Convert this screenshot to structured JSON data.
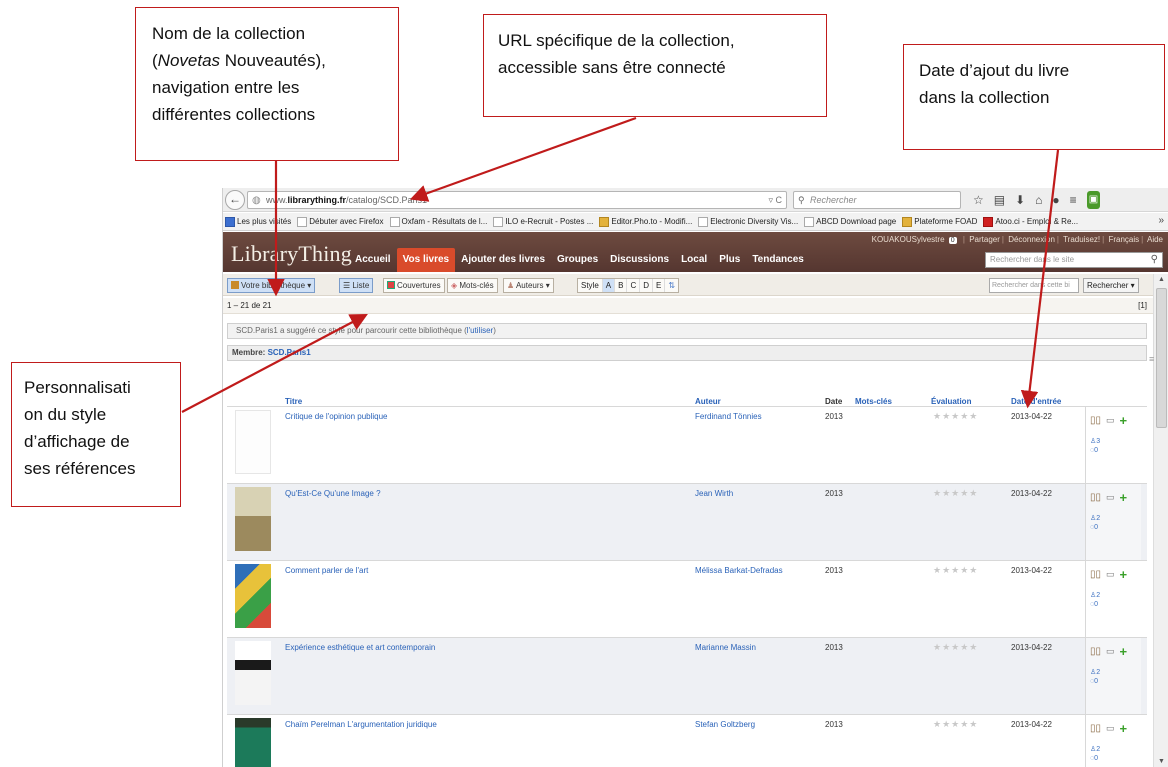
{
  "annotations": {
    "collection_name": {
      "line1": "Nom de la collection",
      "open_paren": "(",
      "italic": "Novetas",
      "rest": " Nouveautés),",
      "line3": "navigation entre les",
      "line4": "différentes collections"
    },
    "specific_url": {
      "line1": "URL spécifique de la collection,",
      "line2": "accessible sans être connecté"
    },
    "entry_date": {
      "line1": "Date d’ajout du livre",
      "line2": "dans la collection"
    },
    "style": {
      "line1": "Personnalisati",
      "line2": "on du style",
      "line3": "d’affichage de",
      "line4": "ses références"
    }
  },
  "browser": {
    "url_prefix": "www.",
    "url_domain": "librarything.fr",
    "url_path": "/catalog/SCD.Paris1",
    "url_controls": "▿ C",
    "search_placeholder": "Rechercher",
    "bookmarks": [
      {
        "label": "Les plus visités",
        "icon": "blue"
      },
      {
        "label": "Débuter avec Firefox",
        "icon": "plain"
      },
      {
        "label": "Oxfam - Résultats de l...",
        "icon": "plain"
      },
      {
        "label": "ILO e-Recruit - Postes ...",
        "icon": "plain"
      },
      {
        "label": "Editor.Pho.to - Modifi...",
        "icon": "gold"
      },
      {
        "label": "Electronic Diversity Vis...",
        "icon": "plain"
      },
      {
        "label": "ABCD Download page",
        "icon": "plain"
      },
      {
        "label": "Plateforme FOAD",
        "icon": "gold"
      },
      {
        "label": "Atoo.ci - Emploi & Re...",
        "icon": "red"
      }
    ],
    "bookmarks_more": "»"
  },
  "site": {
    "logo": "LibraryThing",
    "tabs": [
      "Accueil",
      "Vos livres",
      "Ajouter des livres",
      "Groupes",
      "Discussions",
      "Local",
      "Plus",
      "Tendances"
    ],
    "active_tab": "Vos livres",
    "user": "KOUAKOUSylvestre",
    "user_count": "0",
    "user_links": [
      "Partager",
      "Déconnexion",
      "Traduisez!",
      "Français",
      "Aide"
    ],
    "site_search_placeholder": "Rechercher dans le site"
  },
  "toolbar": {
    "library_button": "Votre bibliothèque",
    "view_list": "Liste",
    "view_covers": "Couvertures",
    "view_tags": "Mots-clés",
    "view_authors": "Auteurs",
    "style_label": "Style",
    "style_letters": [
      "A",
      "B",
      "C",
      "D",
      "E"
    ],
    "catalog_search_placeholder": "Rechercher dans cette bi",
    "catalog_search_button": "Rechercher"
  },
  "catalog": {
    "range": "1 – 21 de 21",
    "pages": "[1]",
    "suggest_text": "SCD.Paris1 a suggéré ce style pour parcourir cette bibliothèque (",
    "suggest_link": "l'utiliser",
    "suggest_close": ")",
    "member_label": "Membre: ",
    "member_name": "SCD.Paris1",
    "columns": {
      "title": "Titre",
      "author": "Auteur",
      "date": "Date",
      "tags": "Mots-clés",
      "rating": "Évaluation",
      "entry_date": "Date d'entrée"
    },
    "stars": "★★★★★",
    "books": [
      {
        "title": "Critique de l'opinion publique",
        "author": "Ferdinand Tönnies",
        "date": "2013",
        "entry_date": "2013-04-22",
        "members": "3",
        "reviews": "0"
      },
      {
        "title": "Qu'Est-Ce Qu'une Image ?",
        "author": "Jean Wirth",
        "date": "2013",
        "entry_date": "2013-04-22",
        "members": "2",
        "reviews": "0"
      },
      {
        "title": "Comment parler de l'art",
        "author": "Mélissa Barkat-Defradas",
        "date": "2013",
        "entry_date": "2013-04-22",
        "members": "2",
        "reviews": "0"
      },
      {
        "title": "Expérience esthétique et art contemporain",
        "author": "Marianne Massin",
        "date": "2013",
        "entry_date": "2013-04-22",
        "members": "2",
        "reviews": "0"
      },
      {
        "title": "Chaïm Perelman L'argumentation juridique",
        "author": "Stefan Goltzberg",
        "date": "2013",
        "entry_date": "2013-04-22",
        "members": "2",
        "reviews": "0"
      }
    ]
  },
  "colors": {
    "annotation_border": "#c01b1b",
    "lt_header": "#63423a",
    "lt_active_tab": "#d94b2b",
    "link": "#2a62b8",
    "plus": "#3aa02a"
  },
  "icons": {
    "back": "back-arrow-icon",
    "bookmark": "bookmark-icon",
    "home": "home-icon",
    "menu": "menu-icon",
    "search": "search-icon",
    "add": "plus-icon"
  }
}
